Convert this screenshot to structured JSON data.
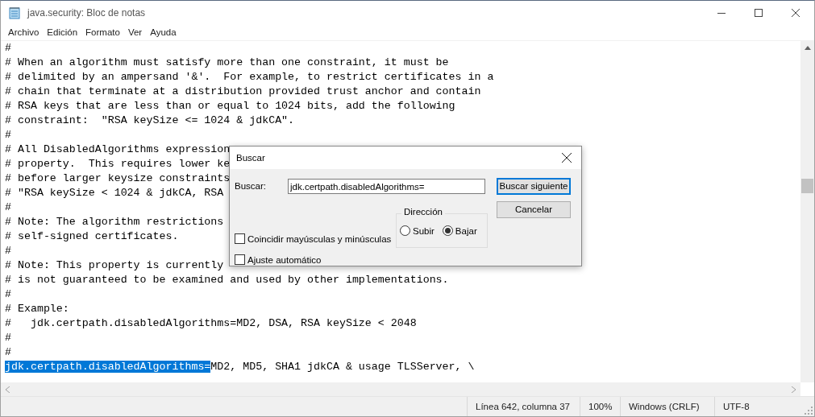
{
  "window": {
    "title": "java.security: Bloc de notas"
  },
  "menu": [
    "Archivo",
    "Edición",
    "Formato",
    "Ver",
    "Ayuda"
  ],
  "editor": {
    "lines": [
      {
        "segments": [
          {
            "text": "#",
            "selected": false
          }
        ]
      },
      {
        "segments": [
          {
            "text": "# When an algorithm must satisfy more than one constraint, it must be",
            "selected": false
          }
        ]
      },
      {
        "segments": [
          {
            "text": "# delimited by an ampersand '&'.  For example, to restrict certificates in a",
            "selected": false
          }
        ]
      },
      {
        "segments": [
          {
            "text": "# chain that terminate at a distribution provided trust anchor and contain",
            "selected": false
          }
        ]
      },
      {
        "segments": [
          {
            "text": "# RSA keys that are less than or equal to 1024 bits, add the following",
            "selected": false
          }
        ]
      },
      {
        "segments": [
          {
            "text": "# constraint:  \"RSA keySize <= 1024 & jdkCA\".",
            "selected": false
          }
        ]
      },
      {
        "segments": [
          {
            "text": "#",
            "selected": false
          }
        ]
      },
      {
        "segments": [
          {
            "text": "# All DisabledAlgorithms expression",
            "selected": false
          }
        ]
      },
      {
        "segments": [
          {
            "text": "# property.  This requires lower ke",
            "selected": false
          }
        ]
      },
      {
        "segments": [
          {
            "text": "# before larger keysize constraints",
            "selected": false
          }
        ]
      },
      {
        "segments": [
          {
            "text": "# \"RSA keySize < 1024 & jdkCA, RSA",
            "selected": false
          }
        ]
      },
      {
        "segments": [
          {
            "text": "#",
            "selected": false
          }
        ]
      },
      {
        "segments": [
          {
            "text": "# Note: The algorithm restrictions",
            "selected": false
          }
        ]
      },
      {
        "segments": [
          {
            "text": "# self-signed certificates.",
            "selected": false
          }
        ]
      },
      {
        "segments": [
          {
            "text": "#",
            "selected": false
          }
        ]
      },
      {
        "segments": [
          {
            "text": "# Note: This property is currently",
            "selected": false
          }
        ]
      },
      {
        "segments": [
          {
            "text": "# is not guaranteed to be examined and used by other implementations.",
            "selected": false
          }
        ]
      },
      {
        "segments": [
          {
            "text": "#",
            "selected": false
          }
        ]
      },
      {
        "segments": [
          {
            "text": "# Example:",
            "selected": false
          }
        ]
      },
      {
        "segments": [
          {
            "text": "#   jdk.certpath.disabledAlgorithms=MD2, DSA, RSA keySize < 2048",
            "selected": false
          }
        ]
      },
      {
        "segments": [
          {
            "text": "#",
            "selected": false
          }
        ]
      },
      {
        "segments": [
          {
            "text": "#",
            "selected": false
          }
        ]
      },
      {
        "segments": [
          {
            "text": "jdk.certpath.disabledAlgorithms=",
            "selected": true
          },
          {
            "text": "MD2, MD5, SHA1 jdkCA & usage TLSServer, \\",
            "selected": false
          }
        ]
      }
    ]
  },
  "find_dialog": {
    "title": "Buscar",
    "find_label": "Buscar:",
    "find_value": "jdk.certpath.disabledAlgorithms=",
    "checkboxes": [
      {
        "label": "Coincidir mayúsculas y minúsculas",
        "checked": false
      },
      {
        "label": "Ajuste automático",
        "checked": false
      }
    ],
    "direction": {
      "label": "Dirección",
      "options": [
        {
          "label": "Subir",
          "selected": false
        },
        {
          "label": "Bajar",
          "selected": true
        }
      ]
    },
    "buttons": [
      {
        "label": "Buscar siguiente",
        "default": true
      },
      {
        "label": "Cancelar",
        "default": false
      }
    ]
  },
  "status_bar": [
    "Línea 642, columna 37",
    "100%",
    "Windows (CRLF)",
    "UTF-8"
  ]
}
